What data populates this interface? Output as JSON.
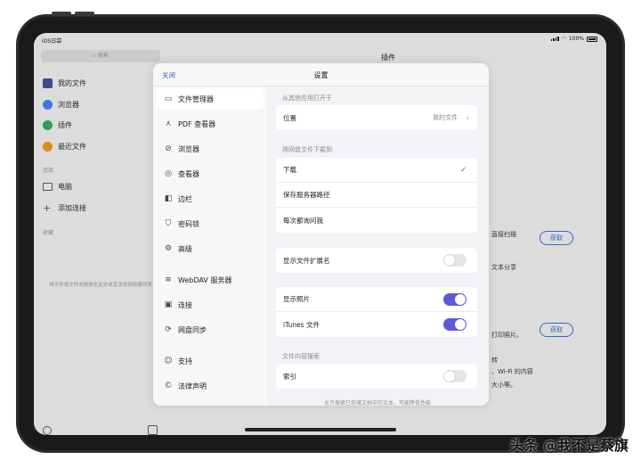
{
  "status": {
    "carrier": "iOS日袋",
    "battery": "100%"
  },
  "sidebar": {
    "search_placeholder": "搜索",
    "items": [
      {
        "label": "我的文件",
        "color": "#3c4a8f"
      },
      {
        "label": "浏览器",
        "color": "#3a7bd5"
      },
      {
        "label": "插件",
        "color": "#2f9e5a"
      },
      {
        "label": "最近文件",
        "color": "#e08a1e"
      }
    ],
    "section_connections": "连接",
    "connections": [
      {
        "label": "电脑"
      },
      {
        "label": "添加连接"
      }
    ],
    "section_favorites": "收藏",
    "favorites_empty": "将文件或文件夹拖放至此处或其添加到收藏列表"
  },
  "main": {
    "title": "插件",
    "frag1": "直接扫描",
    "frag2": "文本分享",
    "frag3": "打印照片。",
    "frag4": "、Wi-Fi 的内容",
    "frag5": "大小等。",
    "frag6": "转",
    "get_label": "获取"
  },
  "modal": {
    "close": "关闭",
    "title": "设置",
    "side_items": [
      {
        "label": "文件管理器",
        "icon": "folder-icon",
        "glyph": "▭"
      },
      {
        "label": "PDF 查看器",
        "icon": "pdf-icon",
        "glyph": "⋏"
      },
      {
        "label": "浏览器",
        "icon": "compass-icon",
        "glyph": "⊘"
      },
      {
        "label": "查看器",
        "icon": "eye-icon",
        "glyph": "◎"
      },
      {
        "label": "边栏",
        "icon": "sidebar-icon",
        "glyph": "◧"
      },
      {
        "label": "密码锁",
        "icon": "shield-icon",
        "glyph": "⛉"
      },
      {
        "label": "高级",
        "icon": "gears-icon",
        "glyph": "⚙"
      },
      {
        "label": "WebDAV 服务器",
        "icon": "server-icon",
        "glyph": "≡"
      },
      {
        "label": "连接",
        "icon": "monitor-icon",
        "glyph": "▣"
      },
      {
        "label": "网盘同步",
        "icon": "sync-icon",
        "glyph": "⟳"
      },
      {
        "label": "支持",
        "icon": "support-icon",
        "glyph": "☺"
      },
      {
        "label": "法律声明",
        "icon": "copyright-icon",
        "glyph": "©"
      }
    ],
    "sec_open_from": "从其他应用打开于",
    "location_label": "位置",
    "location_value": "我的文件",
    "sec_download": "将网盘文件下载到",
    "download_options": [
      "下载",
      "保存服务器路径",
      "每次都询问我"
    ],
    "selected_option": "下载",
    "show_extension_label": "显示文件扩展名",
    "show_extension": false,
    "show_photos_label": "显示照片",
    "show_photos": true,
    "itunes_label": "iTunes 文件",
    "itunes_files": true,
    "sec_content_search": "文件内容搜索",
    "index_label": "索引",
    "index_enabled": false,
    "footnote": "允许搜索已存储文档中的文本，可能降低性能"
  },
  "watermark": "头条 @我不是蔡旗",
  "colors": {
    "accent": "#3c66c7",
    "toggle_on": "#5d5bd4"
  }
}
